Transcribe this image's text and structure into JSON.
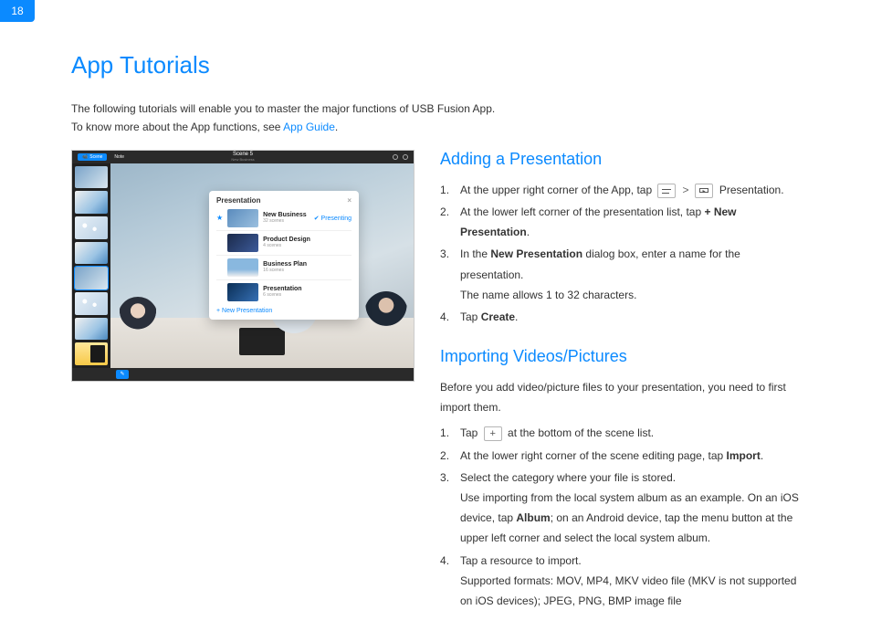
{
  "pageNumber": "18",
  "title": "App Tutorials",
  "intro": {
    "line1": "The following tutorials will enable you to master the major functions of USB Fusion App.",
    "line2_prefix": "To know more about the App functions, see ",
    "line2_link": "App Guide",
    "line2_suffix": "."
  },
  "screenshot": {
    "topLeft": {
      "scene_badge": "Scene",
      "note_badge": "Note"
    },
    "topCenter": {
      "title": "Scene 5",
      "subtitle": "New Business"
    },
    "popup": {
      "title": "Presentation",
      "items": [
        {
          "name": "New Business",
          "sub": "32 scenes",
          "thumb": "rt1",
          "checked": true
        },
        {
          "name": "Product Design",
          "sub": "4 scenes",
          "thumb": "rt2",
          "checked": false
        },
        {
          "name": "Business Plan",
          "sub": "16 scenes",
          "thumb": "rt3",
          "checked": false
        },
        {
          "name": "Presentation",
          "sub": "6 scenes",
          "thumb": "rt4",
          "checked": false
        }
      ],
      "newLabel": "+  New Presentation"
    }
  },
  "section1": {
    "heading": "Adding a Presentation",
    "s1_pre": "At the upper right corner of the App, tap ",
    "s1_post": " Presentation.",
    "s2_pre": "At the lower left corner of the presentation list, tap ",
    "s2_bold": "+ New Presentation",
    "s2_post": ".",
    "s3_pre": "In the ",
    "s3_bold": "New Presentation",
    "s3_mid": " dialog box, enter a name for the presentation.",
    "s3_detail": "The name allows 1 to 32 characters.",
    "s4_pre": "Tap ",
    "s4_bold": "Create",
    "s4_post": "."
  },
  "section2": {
    "heading": "Importing Videos/Pictures",
    "intro": "Before you add video/picture files to your presentation, you need to first import them.",
    "s1_pre": "Tap ",
    "s1_post": " at the bottom of the scene list.",
    "s2_pre": "At the lower right corner of the scene editing page, tap ",
    "s2_bold": "Import",
    "s2_post": ".",
    "s3_line1": "Select the category where your file is stored.",
    "s3_line2_pre": "Use importing from the local system album as an example. On an iOS device, tap ",
    "s3_line2_bold": "Album",
    "s3_line2_post": "; on an Android device, tap the menu button at the upper left corner and select the local system album.",
    "s4_line1": "Tap a resource to import.",
    "s4_line2": "Supported formats: MOV, MP4, MKV video file (MKV is not supported on iOS devices); JPEG, PNG, BMP image file"
  }
}
